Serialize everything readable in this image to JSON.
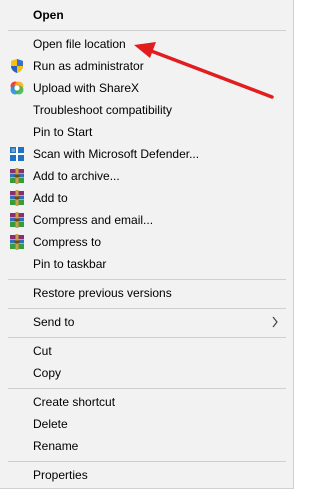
{
  "menu": {
    "items": {
      "open": "Open",
      "open_file_location": "Open file location",
      "run_as_admin": "Run as administrator",
      "upload_sharex": "Upload with ShareX",
      "troubleshoot": "Troubleshoot compatibility",
      "pin_start": "Pin to Start",
      "scan_defender": "Scan with Microsoft Defender...",
      "add_archive": "Add to archive...",
      "add_to": "Add to",
      "compress_email": "Compress and email...",
      "compress_to": "Compress to",
      "pin_taskbar": "Pin to taskbar",
      "restore_versions": "Restore previous versions",
      "send_to": "Send to",
      "cut": "Cut",
      "copy": "Copy",
      "create_shortcut": "Create shortcut",
      "delete": "Delete",
      "rename": "Rename",
      "properties": "Properties"
    },
    "icons": {
      "run_as_admin": "uac-shield-icon",
      "upload_sharex": "sharex-icon",
      "scan_defender": "defender-icon",
      "winrar": "winrar-icon",
      "send_to": "chevron-right-icon"
    },
    "colors": {
      "background": "#f2f2f2",
      "annotation_arrow": "#e21d1d"
    }
  }
}
